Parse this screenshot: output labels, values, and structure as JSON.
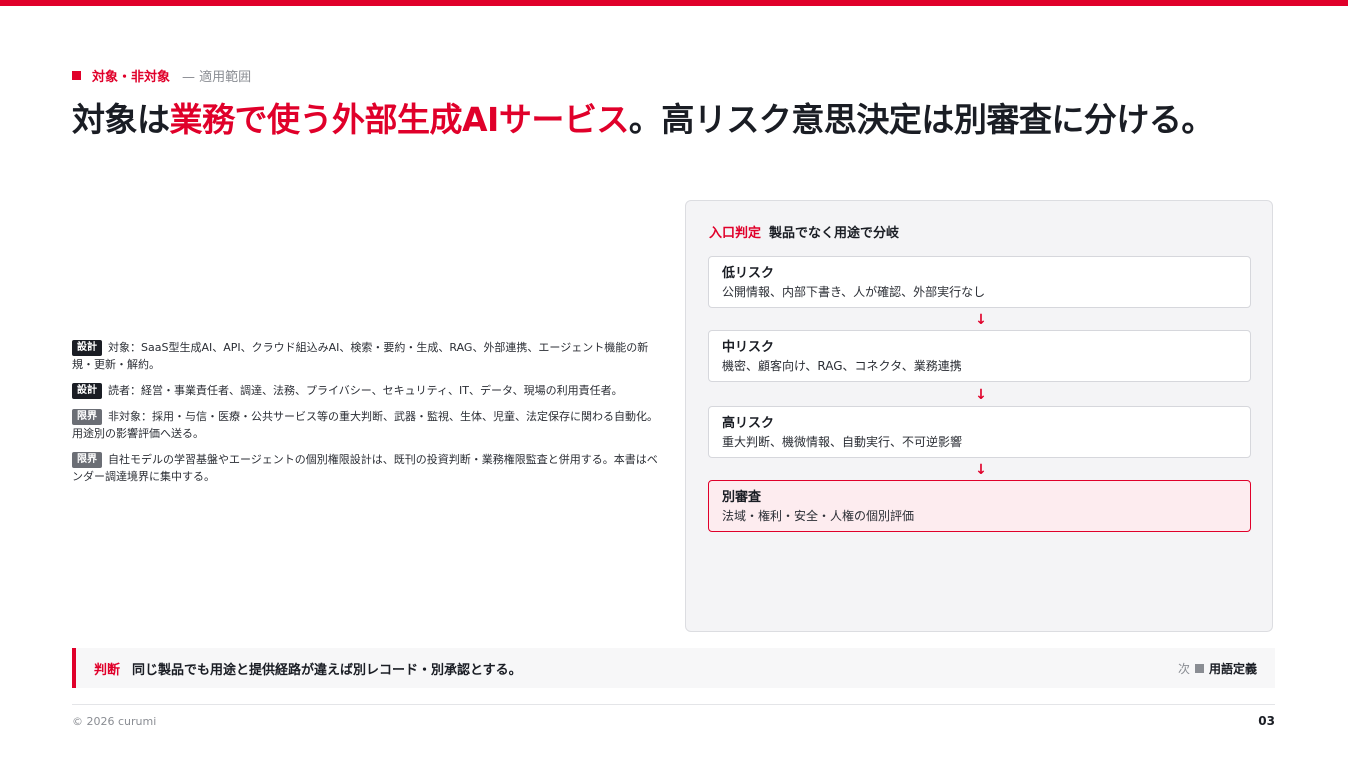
{
  "header": {
    "section_tag": "対象・非対象",
    "section_sub": "— 適用範囲",
    "title_pre": "対象は",
    "title_accent": "業務で使う外部生成AIサービス",
    "title_post": "。高リスク意思決定は別審査に分ける。"
  },
  "notes": [
    {
      "badge": "設計",
      "text": "対象：SaaS型生成AI、API、クラウド組込みAI、検索・要約・生成、RAG、外部連携、エージェント機能の新規・更新・解約。"
    },
    {
      "badge": "設計",
      "text": "読者：経営・事業責任者、調達、法務、プライバシー、セキュリティ、IT、データ、現場の利用責任者。"
    },
    {
      "badge": "限界",
      "text": "非対象：採用・与信・医療・公共サービス等の重大判断、武器・監視、生体、児童、法定保存に関わる自動化。用途別の影響評価へ送る。"
    },
    {
      "badge": "限界",
      "text": "自社モデルの学習基盤やエージェントの個別権限設計は、既刊の投資判断・業務権限監査と併用する。本書はベンダー調達境界に集中する。"
    }
  ],
  "panel": {
    "tag": "入口判定",
    "title": "製品でなく用途で分岐",
    "arrow": "↓",
    "stages": [
      {
        "title": "低リスク",
        "desc": "公開情報、内部下書き、人が確認、外部実行なし"
      },
      {
        "title": "中リスク",
        "desc": "機密、顧客向け、RAG、コネクタ、業務連携"
      },
      {
        "title": "高リスク",
        "desc": "重大判断、機微情報、自動実行、不可逆影響"
      },
      {
        "title": "別審査",
        "desc": "法域・権利・安全・人権の個別評価"
      }
    ]
  },
  "conclusion": {
    "label": "判断",
    "text": "同じ製品でも用途と提供経路が違えば別レコード・別承認とする。",
    "next_label": "次",
    "next_title": "用語定義"
  },
  "footer": {
    "copyright": "© 2026 curumi",
    "page": "03"
  },
  "colors": {
    "accent": "#e0002a",
    "dark": "#1a1d24",
    "muted": "#8a8d93"
  }
}
